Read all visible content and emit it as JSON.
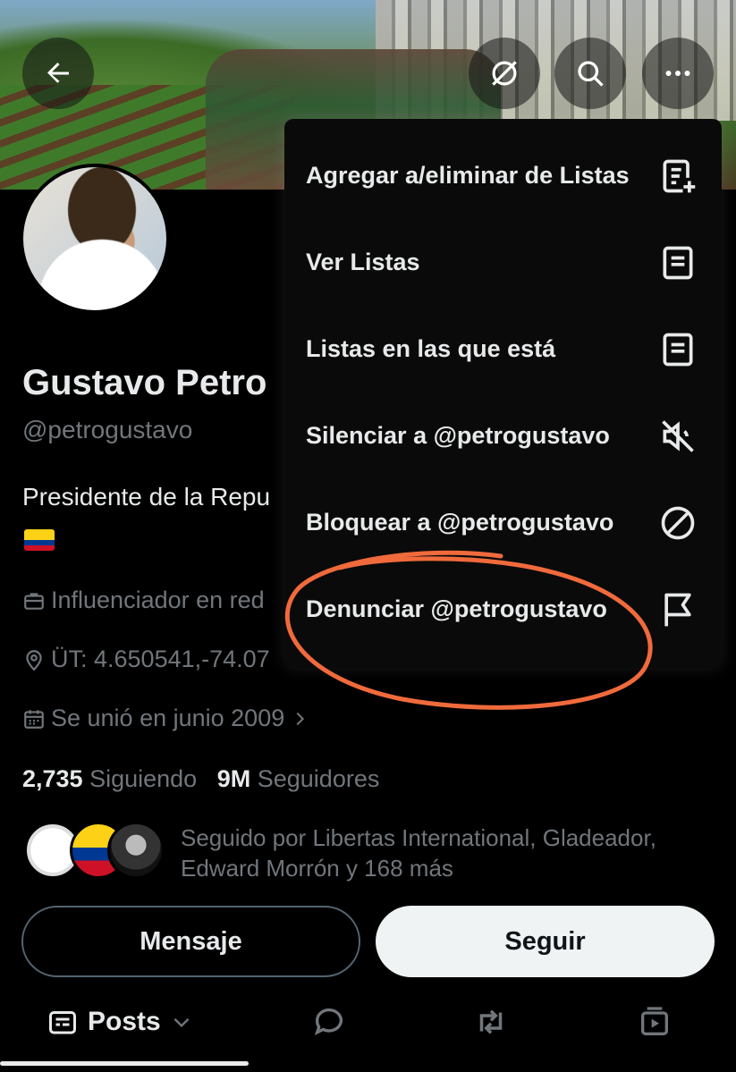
{
  "profile": {
    "name": "Gustavo Petro",
    "handle": "@petrogustavo",
    "bio": "Presidente de la Repu",
    "category": "Influenciador en red",
    "location": "ÜT: 4.650541,-74.07",
    "joined": "Se unió en junio 2009",
    "following_count": "2,735",
    "following_label": "Siguiendo",
    "followers_count": "9M",
    "followers_label": "Seguidores",
    "followed_by": "Seguido por Libertas International, Gladeador, Edward Morrón y 168 más"
  },
  "actions": {
    "message_label": "Mensaje",
    "follow_label": "Seguir"
  },
  "tabs": {
    "posts_label": "Posts"
  },
  "menu": {
    "items": [
      {
        "label": "Agregar a/eliminar de Listas",
        "icon": "list-add-icon"
      },
      {
        "label": "Ver Listas",
        "icon": "list-icon"
      },
      {
        "label": "Listas en las que está",
        "icon": "list-icon"
      },
      {
        "label": "Silenciar a @petrogustavo",
        "icon": "mute-icon"
      },
      {
        "label": "Bloquear a @petrogustavo",
        "icon": "block-icon"
      },
      {
        "label": "Denunciar @petrogustavo",
        "icon": "flag-icon"
      }
    ]
  },
  "colors": {
    "background": "#000000",
    "text_primary": "#e7e9ea",
    "text_secondary": "#71767b",
    "link": "#1d9bf0",
    "annotation": "#f06a3c"
  }
}
